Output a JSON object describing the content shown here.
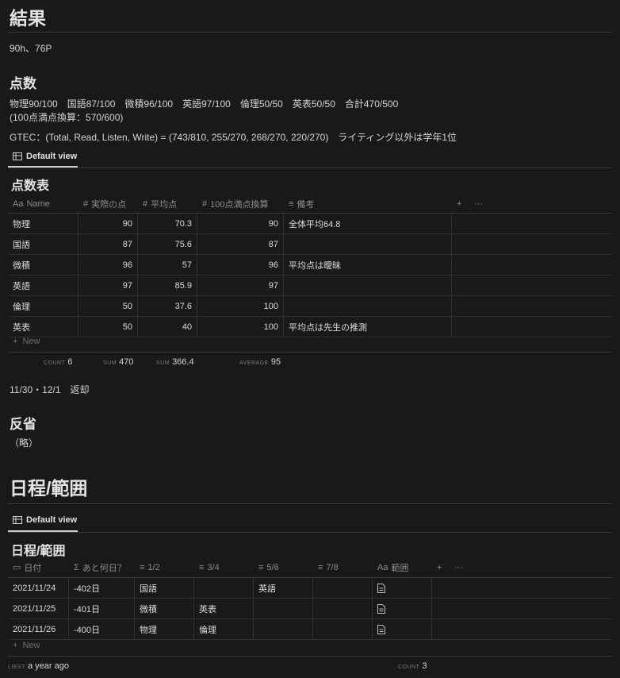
{
  "result": {
    "title": "結果",
    "summary": "90h、76P"
  },
  "score": {
    "title": "点数",
    "line1": "物理90/100　国語87/100　微積96/100　英語97/100　倫理50/50　英表50/50　合計470/500",
    "line2": "(100点満点換算：570/600)",
    "line3": "GTEC：(Total, Read, Listen, Write) = (743/810, 255/270, 268/270, 220/270)　ライティング以外は学年1位"
  },
  "score_table": {
    "view_tab": "Default view",
    "title": "点数表",
    "headers": {
      "name": "Name",
      "actual": "実際の点",
      "average": "平均点",
      "converted": "100点満点換算",
      "notes": "備考"
    },
    "header_icons": {
      "name": "Aa",
      "number": "#",
      "text": "≡",
      "add": "+",
      "more": "···"
    },
    "rows": [
      {
        "name": "物理",
        "actual": "90",
        "average": "70.3",
        "converted": "90",
        "notes": "全体平均64.8"
      },
      {
        "name": "国語",
        "actual": "87",
        "average": "75.6",
        "converted": "87",
        "notes": ""
      },
      {
        "name": "微積",
        "actual": "96",
        "average": "57",
        "converted": "96",
        "notes": "平均点は曖昧"
      },
      {
        "name": "英語",
        "actual": "97",
        "average": "85.9",
        "converted": "97",
        "notes": ""
      },
      {
        "name": "倫理",
        "actual": "50",
        "average": "37.6",
        "converted": "100",
        "notes": ""
      },
      {
        "name": "英表",
        "actual": "50",
        "average": "40",
        "converted": "100",
        "notes": "平均点は先生の推測"
      }
    ],
    "new_label": "New",
    "footer": {
      "count_label": "COUNT",
      "count_value": "6",
      "sum1_label": "SUM",
      "sum1_value": "470",
      "sum2_label": "SUM",
      "sum2_value": "366.4",
      "avg_label": "AVERAGE",
      "avg_value": "95"
    }
  },
  "return_note": "11/30・12/1　返却",
  "reflection": {
    "title": "反省",
    "body": "（略）"
  },
  "schedule": {
    "title": "日程/範囲",
    "view_tab": "Default view",
    "table_title": "日程/範囲",
    "headers": {
      "date": "日付",
      "days_left": "あと何日？",
      "c12": "1/2",
      "c34": "3/4",
      "c56": "5/6",
      "c78": "7/8",
      "scope": "範囲"
    },
    "header_icons": {
      "date": "▭",
      "formula": "Σ",
      "text": "≡",
      "title": "Aa",
      "add": "+",
      "more": "···"
    },
    "rows": [
      {
        "date": "2021/11/24",
        "days_left": "-402日",
        "c12": "国語",
        "c34": "",
        "c56": "英語",
        "c78": ""
      },
      {
        "date": "2021/11/25",
        "days_left": "-401日",
        "c12": "微積",
        "c34": "英表",
        "c56": "",
        "c78": ""
      },
      {
        "date": "2021/11/26",
        "days_left": "-400日",
        "c12": "物理",
        "c34": "倫理",
        "c56": "",
        "c78": ""
      }
    ],
    "new_label": "New",
    "footer": {
      "latest_label": "LIEST",
      "latest_value": "a year ago",
      "count_label": "COUNT",
      "count_value": "3"
    }
  }
}
